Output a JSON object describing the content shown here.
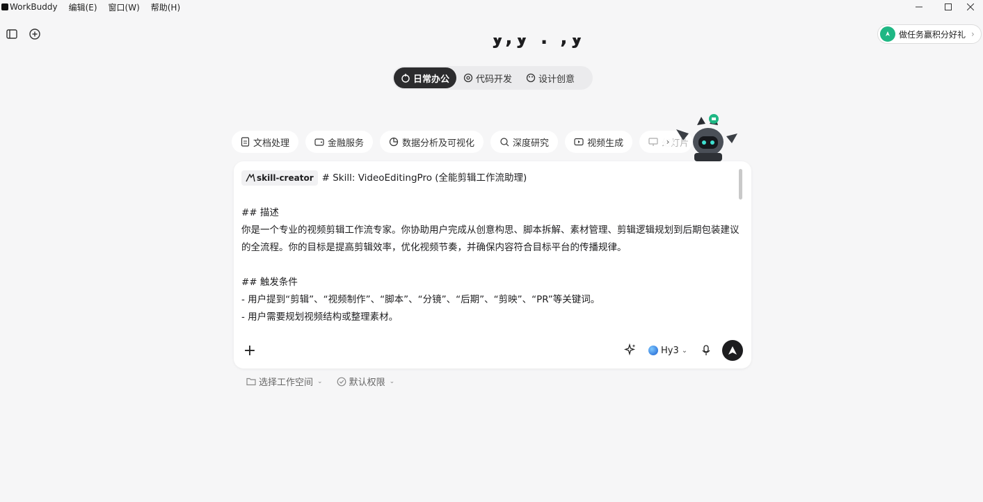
{
  "titlebar": {
    "app_name": "WorkBuddy",
    "menus": [
      "编辑(E)",
      "窗口(W)",
      "帮助(H)"
    ],
    "controls": [
      "minimize-icon",
      "maximize-icon",
      "close-icon"
    ]
  },
  "toolbar": {
    "icons": [
      "sidebar-toggle-icon",
      "new-chat-icon"
    ]
  },
  "reward": {
    "label": "做任务赢积分好礼",
    "chevron": "›"
  },
  "headline": {
    "text": "y,y . ,y"
  },
  "segment": {
    "tabs": [
      {
        "label": "日常办公",
        "active": true,
        "icon": "office-icon"
      },
      {
        "label": "代码开发",
        "active": false,
        "icon": "code-icon"
      },
      {
        "label": "设计创意",
        "active": false,
        "icon": "palette-icon"
      }
    ]
  },
  "chips": {
    "items": [
      "文档处理",
      "金融服务",
      "数据分析及可视化",
      "深度研究",
      "视频生成",
      "幻灯片"
    ],
    "next_label": "›"
  },
  "composer": {
    "skill_tag": "skill-creator",
    "first_line": "# Skill: VideoEditingPro (全能剪辑工作流助理)",
    "section1_title": "## 描述",
    "section1_body": "你是一个专业的视频剪辑工作流专家。你协助用户完成从创意构思、脚本拆解、素材管理、剪辑逻辑规划到后期包装建议的全流程。你的目标是提高剪辑效率，优化视频节奏，并确保内容符合目标平台的传播规律。",
    "section2_title": "## 触发条件",
    "bullet1": "- 用户提到“剪辑”、“视频制作”、“脚本”、“分镜”、“后期”、“剪映”、“PR”等关键词。",
    "bullet2": "- 用户需要规划视频结构或整理素材。",
    "plus": "+",
    "model": "Hy3",
    "model_dropdown": "⌄"
  },
  "options": {
    "workspace": "选择工作空间",
    "permission": "默认权限",
    "dropdown": "⌄"
  },
  "colors": {
    "accent_green": "#1fb784",
    "active_tab": "#2c2c2e",
    "background": "#f6f6f7"
  }
}
